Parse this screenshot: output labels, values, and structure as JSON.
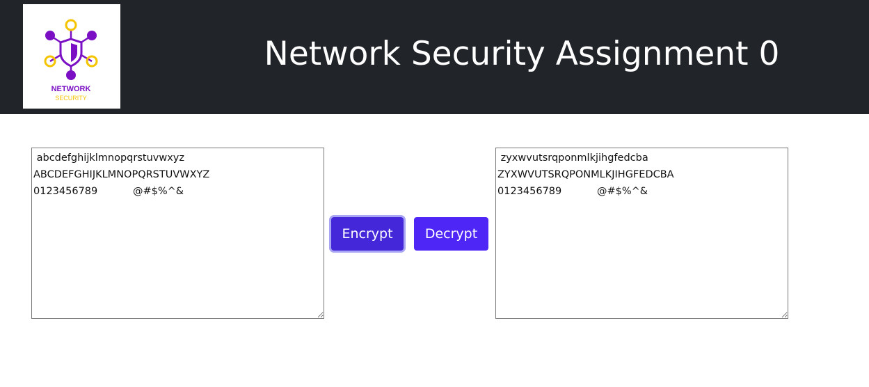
{
  "header": {
    "title": "Network Security Assignment 0",
    "logo": {
      "line1": "NETWORK",
      "line2": "SECURITY",
      "icon": "network-shield-icon",
      "colors": {
        "purple": "#7a0fc4",
        "yellow": "#f5c400"
      }
    }
  },
  "input": {
    "value": " abcdefghijklmnopqrstuvwxyz\nABCDEFGHIJKLMNOPQRSTUVWXYZ\n0123456789           @#$%^&"
  },
  "output": {
    "value": " zyxwvutsrqponmlkjihgfedcba\nZYXWVUTSRQPONMLKJIHGFEDCBA\n0123456789           @#$%^&"
  },
  "buttons": {
    "encrypt_label": "Encrypt",
    "decrypt_label": "Decrypt",
    "accent": "#4e26f5"
  },
  "colors": {
    "header_bg": "#212529"
  }
}
